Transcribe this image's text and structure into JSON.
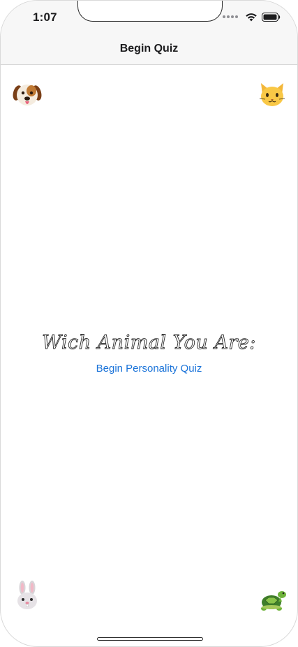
{
  "status_bar": {
    "time": "1:07",
    "icons": [
      "cellular-dots-icon",
      "wifi-icon",
      "battery-icon"
    ]
  },
  "nav_bar": {
    "title": "Begin Quiz"
  },
  "main": {
    "heading": "Wich Animal You Are:",
    "button_label": "Begin Personality Quiz",
    "link_color": "#1a73d9"
  },
  "corner_emojis": [
    "dog-face-icon",
    "cat-face-icon",
    "rabbit-face-icon",
    "turtle-icon"
  ]
}
